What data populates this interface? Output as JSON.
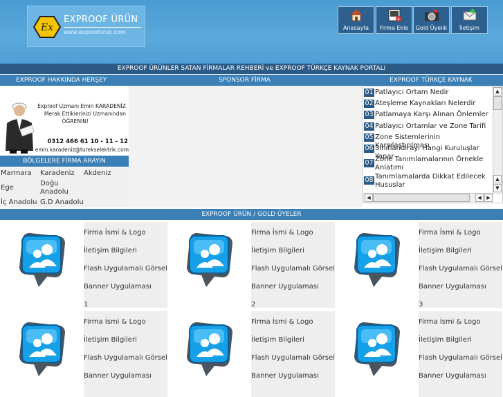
{
  "header": {
    "logo_title": "EXPROOF ÜRÜN",
    "logo_url": "www.exproofurun.com",
    "nav": [
      {
        "label": "Anasayfa",
        "icon": "home-icon"
      },
      {
        "label": "Firma Ekle",
        "icon": "add-company-icon"
      },
      {
        "label": "Gold Üyelik",
        "icon": "gold-membership-icon"
      },
      {
        "label": "İletişim",
        "icon": "contact-icon"
      }
    ]
  },
  "portal_title": "EXPROOF ÜRÜNLER SATAN FİRMALAR REHBERİ ve EXPROOF TÜRKÇE KAYNAK PORTALI",
  "columns": {
    "left": "EXPROOF HAKKINDA HERŞEY",
    "middle": "SPONSOR FİRMA",
    "right": "EXPROOF TÜRKÇE KAYNAK"
  },
  "expert": {
    "line1": "Exproof Uzmanı Emin KARADENİZ",
    "line2": "Merak Ettiklerinizi Uzmanından",
    "line3": "ÖĞRENİN!",
    "phone": "0312 466 61 10 - 11 - 12",
    "email": "emin.karadeniz@turekselektrik.com"
  },
  "regions": {
    "title": "BÖLGELERE FİRMA ARAYIN",
    "items": [
      "Marmara",
      "Karadeniz",
      "Akdeniz",
      "Ege",
      "Doğu Anadolu",
      "İç Anadolu",
      "G.D Anadolu"
    ]
  },
  "sources": [
    {
      "n": "01",
      "t": "Patlayıcı Ortam Nedir"
    },
    {
      "n": "02",
      "t": "Ateşleme Kaynakları Nelerdir"
    },
    {
      "n": "03",
      "t": "Patlamaya Karşı Alınan Önlemler"
    },
    {
      "n": "04",
      "t": "Patlayıcı Ortamlar ve Zone Tarifi"
    },
    {
      "n": "05",
      "t": "Zone Sistemlerinin Karşılaştırılması"
    },
    {
      "n": "06",
      "t": "Sınıflandırayı Hangi Kuruluşlar Yapar"
    },
    {
      "n": "07",
      "t": "Zone Tanımlamalarının Örnekle Anlatımı"
    },
    {
      "n": "08",
      "t": "Tanımlamalarda Dikkat Edilecek Hususlar"
    }
  ],
  "gold": {
    "title": "EXPROOF ÜRÜN / GOLD ÜYELER",
    "lines": [
      "Firma İsmi & Logo",
      "İletişim Bilgileri",
      "Flash Uygulamalı Görsel",
      "Banner Uygulaması"
    ],
    "cards": [
      "1",
      "2",
      "3",
      "",
      "",
      ""
    ]
  },
  "colors": {
    "header": "#5aa9dc",
    "bar_dark": "#2b5a86",
    "bar": "#3a7fb5",
    "logo_badge": "#f5c400"
  }
}
